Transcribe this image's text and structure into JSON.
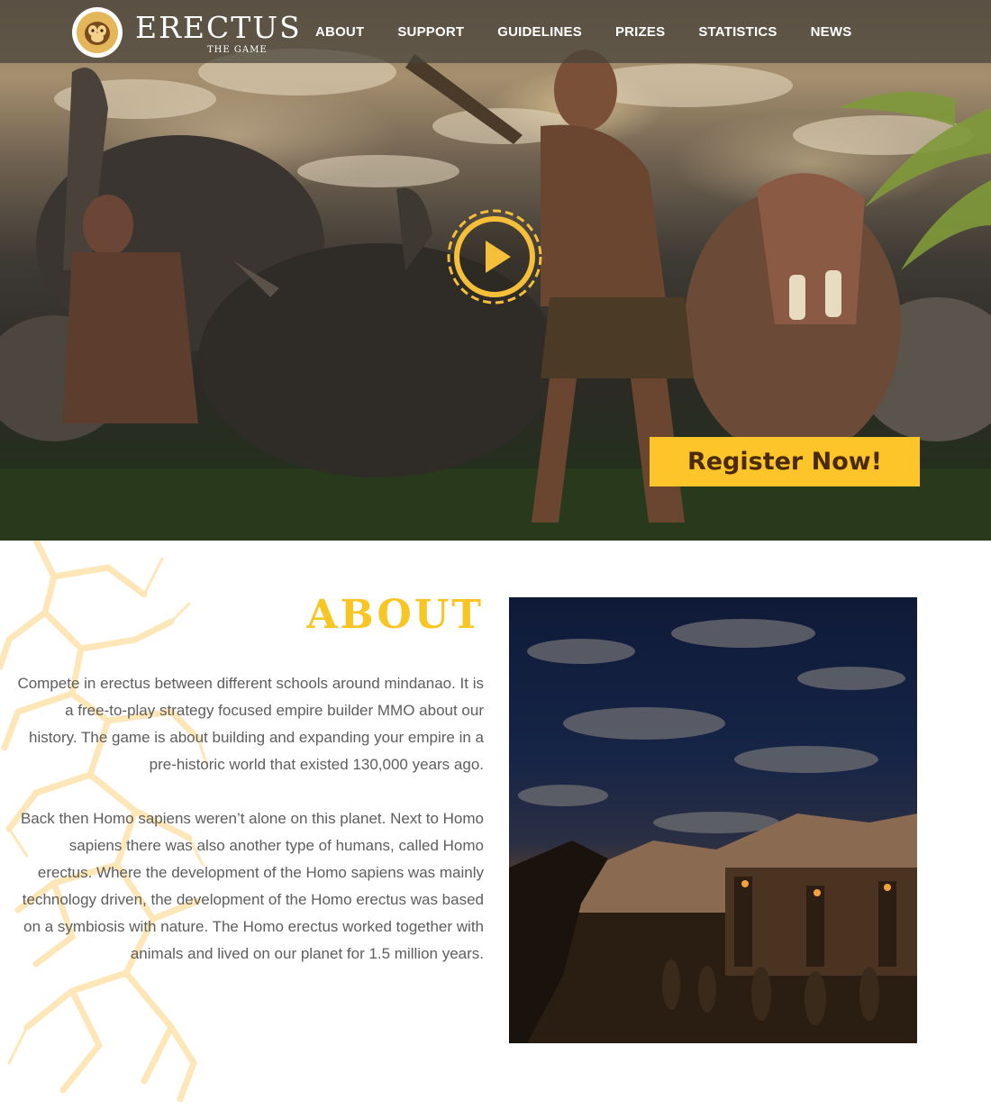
{
  "brand": {
    "name": "ERECTUS",
    "tagline": "THE GAME",
    "logo_icon": "monkey-face-icon"
  },
  "nav": {
    "items": [
      {
        "label": "ABOUT"
      },
      {
        "label": "SUPPORT"
      },
      {
        "label": "GUIDELINES"
      },
      {
        "label": "PRIZES"
      },
      {
        "label": "STATISTICS"
      },
      {
        "label": "NEWS"
      }
    ]
  },
  "hero": {
    "play_icon": "play-icon",
    "register_label": "Register Now!"
  },
  "about": {
    "title": "ABOUT",
    "paragraphs": [
      "Compete in erectus between different schools around mindanao. It is a free-to-play strategy focused empire builder MMO about our history. The game is about building and expanding your empire in a pre-historic world that existed 130,000 years ago.",
      "Back then Homo sapiens weren’t alone on this planet. Next to Homo sapiens there was also another type of humans, called Homo erectus. Where the development of the Homo sapiens was mainly technology driven, the development of the Homo erectus was based on a symbiosis with nature. The Homo erectus worked together with animals and lived on our planet for 1.5 million years."
    ]
  },
  "colors": {
    "accent_yellow": "#fdc52a",
    "title_yellow": "#f7c624",
    "button_text": "#4a2b07",
    "body_text": "#5d5d5d",
    "crack_color": "#fde7b8"
  }
}
